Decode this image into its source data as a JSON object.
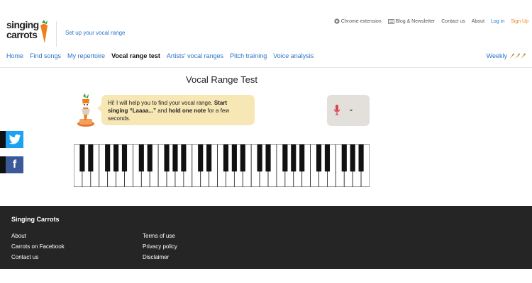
{
  "header": {
    "logo_line1": "singing",
    "logo_line2": "carrots",
    "setup_link": "Set up your vocal range",
    "top_links": {
      "chrome_extension": "Chrome extension",
      "blog_newsletter": "Blog & Newsletter",
      "contact_us": "Contact us",
      "about": "About",
      "log_in": "Log in",
      "sign_up": "Sign Up"
    }
  },
  "nav": {
    "items": [
      "Home",
      "Find songs",
      "My repertoire",
      "Vocal range test",
      "Artists' vocal ranges",
      "Pitch training",
      "Voice analysis"
    ],
    "active_index": 3,
    "weekly": "Weekly"
  },
  "main": {
    "title": "Vocal Range Test",
    "bubble": {
      "part1": "Hi! I will help you to find your vocal range. ",
      "bold1": "Start singing “Laaaa...”",
      "part2": " and ",
      "bold2": "hold one note",
      "part3": " for a few seconds."
    },
    "note_readout": "-"
  },
  "piano": {
    "white_keys": 35
  },
  "footer": {
    "title": "Singing Carrots",
    "col1": [
      "About",
      "Carrots on Facebook",
      "Contact us"
    ],
    "col2": [
      "Terms of use",
      "Privacy policy",
      "Disclaimer"
    ]
  },
  "colors": {
    "link": "#2a72c9",
    "signup": "#f07f1b",
    "bubble": "#f6e7b4",
    "footer_bg": "#252525",
    "twitter": "#1da1f2",
    "facebook": "#3b5998"
  },
  "icons": {
    "chrome": "chrome-icon",
    "blog": "newsletter-icon",
    "mic": "microphone-icon",
    "weekly": "carrot-icon"
  }
}
